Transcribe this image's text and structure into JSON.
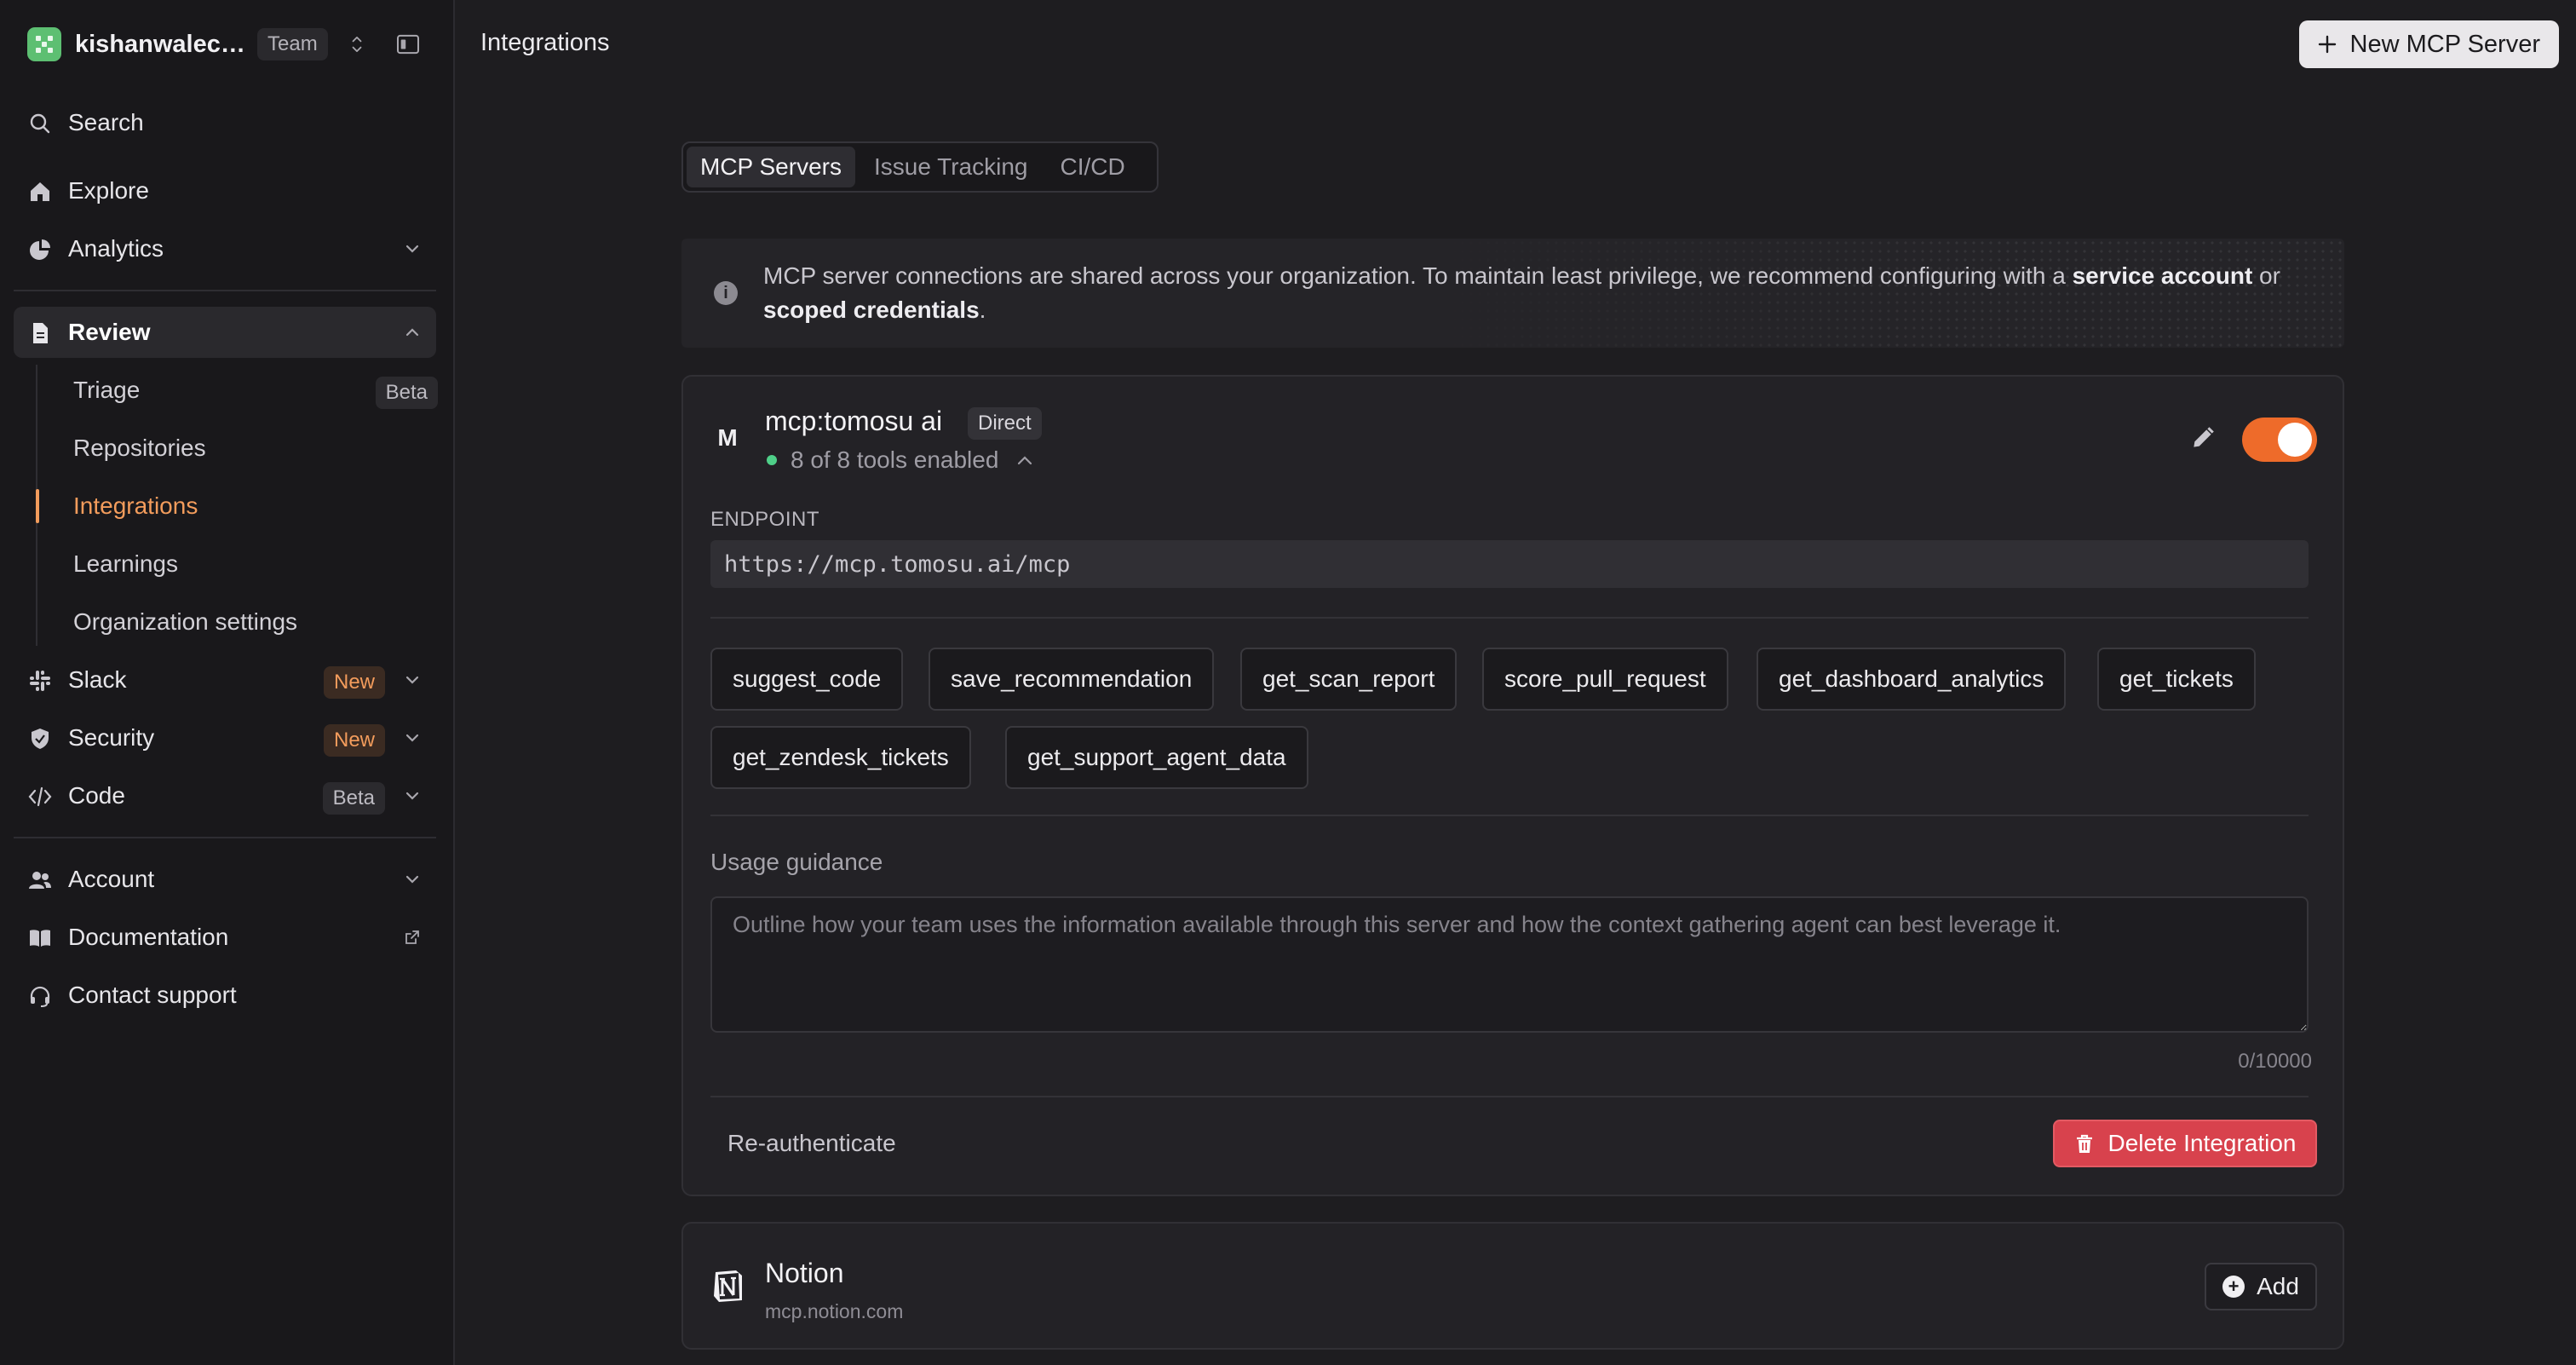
{
  "workspace": {
    "name": "kishanwalech...",
    "plan_badge": "Team"
  },
  "sidebar": {
    "search": "Search",
    "explore": "Explore",
    "analytics": "Analytics",
    "review": "Review",
    "review_items": [
      {
        "label": "Triage",
        "badge": "Beta"
      },
      {
        "label": "Repositories"
      },
      {
        "label": "Integrations"
      },
      {
        "label": "Learnings"
      },
      {
        "label": "Organization settings"
      }
    ],
    "slack": {
      "label": "Slack",
      "badge": "New"
    },
    "security": {
      "label": "Security",
      "badge": "New"
    },
    "code": {
      "label": "Code",
      "badge": "Beta"
    },
    "account": "Account",
    "documentation": "Documentation",
    "contact_support": "Contact support"
  },
  "header": {
    "title": "Integrations",
    "new_button": "New MCP Server"
  },
  "tabs": [
    "MCP Servers",
    "Issue Tracking",
    "CI/CD"
  ],
  "banner": {
    "text_1": "MCP server connections are shared across your organization. To maintain least privilege, we recommend configuring with a ",
    "bold_1": "service account",
    "text_2": " or ",
    "bold_2": "scoped credentials",
    "text_3": "."
  },
  "server": {
    "avatar": "M",
    "name": "mcp:tomosu ai",
    "badge": "Direct",
    "status": "8 of 8 tools enabled",
    "enabled": true,
    "endpoint_label": "ENDPOINT",
    "endpoint": "https://mcp.tomosu.ai/mcp",
    "tools": [
      "suggest_code",
      "save_recommendation",
      "get_scan_report",
      "score_pull_request",
      "get_dashboard_analytics",
      "get_tickets",
      "get_zendesk_tickets",
      "get_support_agent_data"
    ],
    "usage_label": "Usage guidance",
    "usage_placeholder": "Outline how your team uses the information available through this server and how the context gathering agent can best leverage it.",
    "usage_count": "0/10000",
    "reauth": "Re-authenticate",
    "delete": "Delete Integration"
  },
  "notion": {
    "name": "Notion",
    "url": "mcp.notion.com",
    "add": "Add"
  },
  "colors": {
    "accent": "#ee6b2a",
    "active_link": "#f39c5c",
    "danger": "#d8424d",
    "status_ok": "#4fd089"
  }
}
